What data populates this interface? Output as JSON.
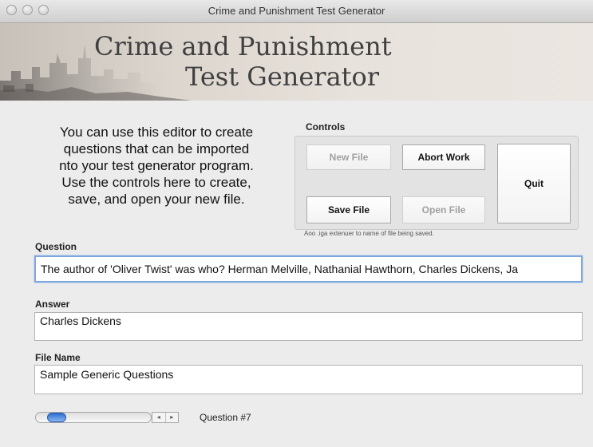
{
  "window": {
    "title": "Crime and Punishment Test Generator"
  },
  "banner": {
    "title_line1": "Crime and Punishment",
    "title_line2": "Test Generator"
  },
  "intro": {
    "line1": "You can use this editor to create",
    "line2": "questions that can be imported",
    "line3": "nto your test generator program.",
    "line4": "Use the controls here to create,",
    "line5": "save, and open your new file."
  },
  "controls": {
    "label": "Controls",
    "new_file": "New File",
    "abort_work": "Abort Work",
    "quit": "Quit",
    "save_file": "Save File",
    "open_file": "Open File",
    "hint": "Aoo .iga extenuer to name of file being saved."
  },
  "question": {
    "label": "Question",
    "value": "The author of 'Oliver Twist' was who? Herman Melville, Nathanial Hawthorn, Charles Dickens, Ja"
  },
  "answer": {
    "label": "Answer",
    "value": "Charles Dickens"
  },
  "file_name": {
    "label": "File Name",
    "value": "Sample Generic Questions"
  },
  "navigator": {
    "question_number": "Question #7",
    "prev_arrow": "◂",
    "next_arrow": "▸"
  }
}
